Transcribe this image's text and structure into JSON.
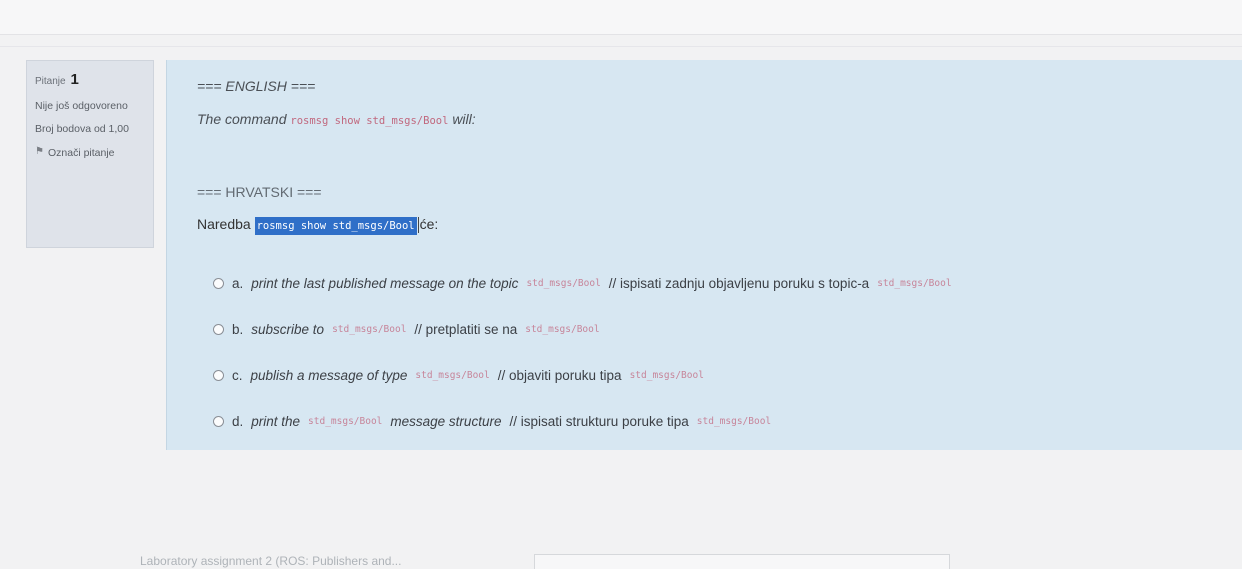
{
  "question_info": {
    "label": "Pitanje",
    "number": "1",
    "status": "Nije još odgovoreno",
    "score": "Broj bodova od 1,00",
    "flag_label": "Označi pitanje"
  },
  "question": {
    "en_heading": "=== ENGLISH ===",
    "en_prefix": "The command",
    "en_code": "rosmsg show std_msgs/Bool",
    "en_suffix": "will:",
    "hr_heading": "=== HRVATSKI ===",
    "hr_prefix": "Naredba",
    "hr_code": "rosmsg show std_msgs/Bool",
    "hr_suffix": "će:"
  },
  "answers": [
    {
      "letter": "a.",
      "en": "print the last published message on the topic",
      "code1": "std_msgs/Bool",
      "hr": "// ispisati zadnju objavljenu poruku s topic-a",
      "code2": "std_msgs/Bool"
    },
    {
      "letter": "b.",
      "en": "subscribe to",
      "code1": "std_msgs/Bool",
      "hr": "// pretplatiti se na",
      "code2": "std_msgs/Bool"
    },
    {
      "letter": "c.",
      "en": "publish a message of type",
      "code1": "std_msgs/Bool",
      "hr": "// objaviti poruku tipa",
      "code2": "std_msgs/Bool"
    },
    {
      "letter": "d.",
      "en": "print the",
      "code1": "std_msgs/Bool",
      "en2": "message structure",
      "hr": "// ispisati strukturu poruke tipa",
      "code2": "std_msgs/Bool"
    }
  ],
  "footer": {
    "nav_link": "Laboratory assignment 2 (ROS: Publishers and..."
  },
  "colors": {
    "panel_bg": "#d7e7f2",
    "info_bg": "#dfe3ea",
    "code_color": "#c1687e",
    "highlight": "#2f6fc8"
  }
}
